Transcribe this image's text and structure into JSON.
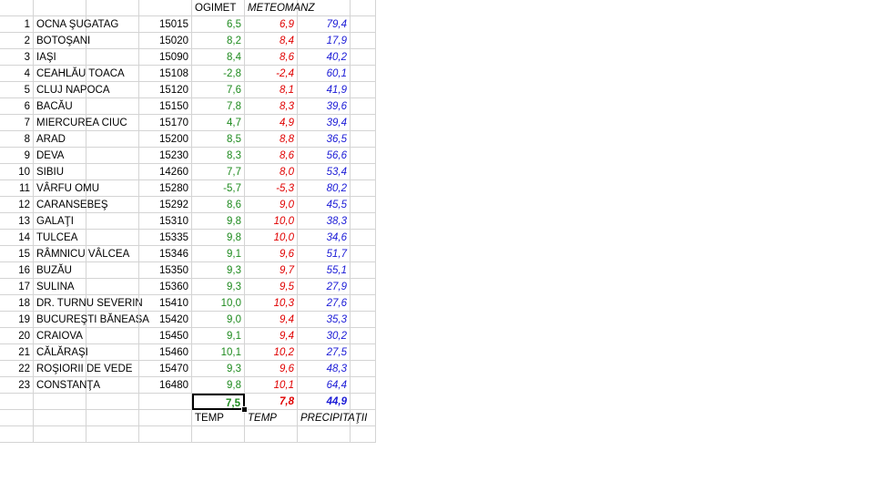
{
  "colors": {
    "ogimet": "#1e8a1e",
    "meteomanz": "#e00000",
    "precip": "#1a1ad6",
    "grid": "#d4d4d4"
  },
  "header": {
    "ogimet": "OGIMET",
    "meteomanz": "METEOMANZ"
  },
  "rows": [
    {
      "n": "1",
      "name": "OCNA ŞUGATAG",
      "code": "15015",
      "og": "6,5",
      "mm": "6,9",
      "pr": "79,4"
    },
    {
      "n": "2",
      "name": "BOTOŞANI",
      "code": "15020",
      "og": "8,2",
      "mm": "8,4",
      "pr": "17,9"
    },
    {
      "n": "3",
      "name": "IAŞI",
      "code": "15090",
      "og": "8,4",
      "mm": "8,6",
      "pr": "40,2"
    },
    {
      "n": "4",
      "name": "CEAHLĂU TOACA",
      "code": "15108",
      "og": "-2,8",
      "mm": "-2,4",
      "pr": "60,1"
    },
    {
      "n": "5",
      "name": "CLUJ NAPOCA",
      "code": "15120",
      "og": "7,6",
      "mm": "8,1",
      "pr": "41,9"
    },
    {
      "n": "6",
      "name": "BACĂU",
      "code": "15150",
      "og": "7,8",
      "mm": "8,3",
      "pr": "39,6"
    },
    {
      "n": "7",
      "name": "MIERCUREA CIUC",
      "code": "15170",
      "og": "4,7",
      "mm": "4,9",
      "pr": "39,4"
    },
    {
      "n": "8",
      "name": "ARAD",
      "code": "15200",
      "og": "8,5",
      "mm": "8,8",
      "pr": "36,5"
    },
    {
      "n": "9",
      "name": "DEVA",
      "code": "15230",
      "og": "8,3",
      "mm": "8,6",
      "pr": "56,6"
    },
    {
      "n": "10",
      "name": "SIBIU",
      "code": "14260",
      "og": "7,7",
      "mm": "8,0",
      "pr": "53,4"
    },
    {
      "n": "11",
      "name": "VÂRFU OMU",
      "code": "15280",
      "og": "-5,7",
      "mm": "-5,3",
      "pr": "80,2"
    },
    {
      "n": "12",
      "name": "CARANSEBEŞ",
      "code": "15292",
      "og": "8,6",
      "mm": "9,0",
      "pr": "45,5"
    },
    {
      "n": "13",
      "name": "GALAŢI",
      "code": "15310",
      "og": "9,8",
      "mm": "10,0",
      "pr": "38,3"
    },
    {
      "n": "14",
      "name": "TULCEA",
      "code": "15335",
      "og": "9,8",
      "mm": "10,0",
      "pr": "34,6"
    },
    {
      "n": "15",
      "name": "RÂMNICU VÂLCEA",
      "code": "15346",
      "og": "9,1",
      "mm": "9,6",
      "pr": "51,7"
    },
    {
      "n": "16",
      "name": "BUZĂU",
      "code": "15350",
      "og": "9,3",
      "mm": "9,7",
      "pr": "55,1"
    },
    {
      "n": "17",
      "name": "SULINA",
      "code": "15360",
      "og": "9,3",
      "mm": "9,5",
      "pr": "27,9"
    },
    {
      "n": "18",
      "name": "DR. TURNU SEVERIN",
      "code": "15410",
      "og": "10,0",
      "mm": "10,3",
      "pr": "27,6"
    },
    {
      "n": "19",
      "name": "BUCUREŞTI BĂNEASA",
      "code": "15420",
      "og": "9,0",
      "mm": "9,4",
      "pr": "35,3"
    },
    {
      "n": "20",
      "name": "CRAIOVA",
      "code": "15450",
      "og": "9,1",
      "mm": "9,4",
      "pr": "30,2"
    },
    {
      "n": "21",
      "name": "CĂLĂRAŞI",
      "code": "15460",
      "og": "10,1",
      "mm": "10,2",
      "pr": "27,5"
    },
    {
      "n": "22",
      "name": "ROŞIORII DE VEDE",
      "code": "15470",
      "og": "9,3",
      "mm": "9,6",
      "pr": "48,3"
    },
    {
      "n": "23",
      "name": "CONSTANŢA",
      "code": "16480",
      "og": "9,8",
      "mm": "10,1",
      "pr": "64,4"
    }
  ],
  "averages": {
    "og": "7,5",
    "mm": "7,8",
    "pr": "44,9"
  },
  "footer": {
    "og": "TEMP",
    "mm": "TEMP",
    "pr": "PRECIPITAŢII"
  }
}
